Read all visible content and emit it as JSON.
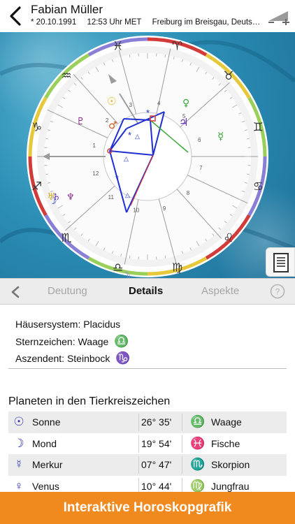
{
  "header": {
    "name": "Fabian Müller",
    "birth": "* 20.10.1991",
    "time": "12:53 Uhr MET",
    "place": "Freiburg im Breisgau, Deuts…"
  },
  "chart": {
    "house_numbers": [
      "1",
      "2",
      "3",
      "4",
      "5",
      "6",
      "7",
      "8",
      "9",
      "10",
      "11",
      "12"
    ],
    "zodiac_glyphs": [
      "♑",
      "♒",
      "♓",
      "♈",
      "♉",
      "♊",
      "♋",
      "♌",
      "♍",
      "♎",
      "♏",
      "♐"
    ],
    "colors": {
      "fire": "#d33b3b",
      "earth": "#e6c83a",
      "air": "#9ad05a",
      "water": "#8a7fd6",
      "aspect": "#1f2fd1",
      "planet_blue": "#2a2fb5"
    }
  },
  "tabs": {
    "deutung": "Deutung",
    "details": "Details",
    "aspekte": "Aspekte"
  },
  "info": {
    "haeuser_label": "Häusersystem:",
    "haeuser_value": "Placidus",
    "sternzeichen_label": "Sternzeichen:",
    "sternzeichen_value": "Waage",
    "sternzeichen_glyph": "♎",
    "aszendent_label": "Aszendent:",
    "aszendent_value": "Steinbock",
    "aszendent_glyph": "♑"
  },
  "planets": {
    "title": "Planeten in den Tierkreiszeichen",
    "rows": [
      {
        "glyph": "☉",
        "name": "Sonne",
        "degree": "26° 35'",
        "sign_glyph": "♎",
        "sign": "Waage"
      },
      {
        "glyph": "☽",
        "name": "Mond",
        "degree": "19° 54'",
        "sign_glyph": "♓",
        "sign": "Fische"
      },
      {
        "glyph": "☿",
        "name": "Merkur",
        "degree": "07° 47'",
        "sign_glyph": "♏",
        "sign": "Skorpion"
      },
      {
        "glyph": "♀",
        "name": "Venus",
        "degree": "10° 44'",
        "sign_glyph": "♍",
        "sign": "Jungfrau"
      }
    ]
  },
  "banner": {
    "label": "Interaktive Horoskopgrafik"
  }
}
